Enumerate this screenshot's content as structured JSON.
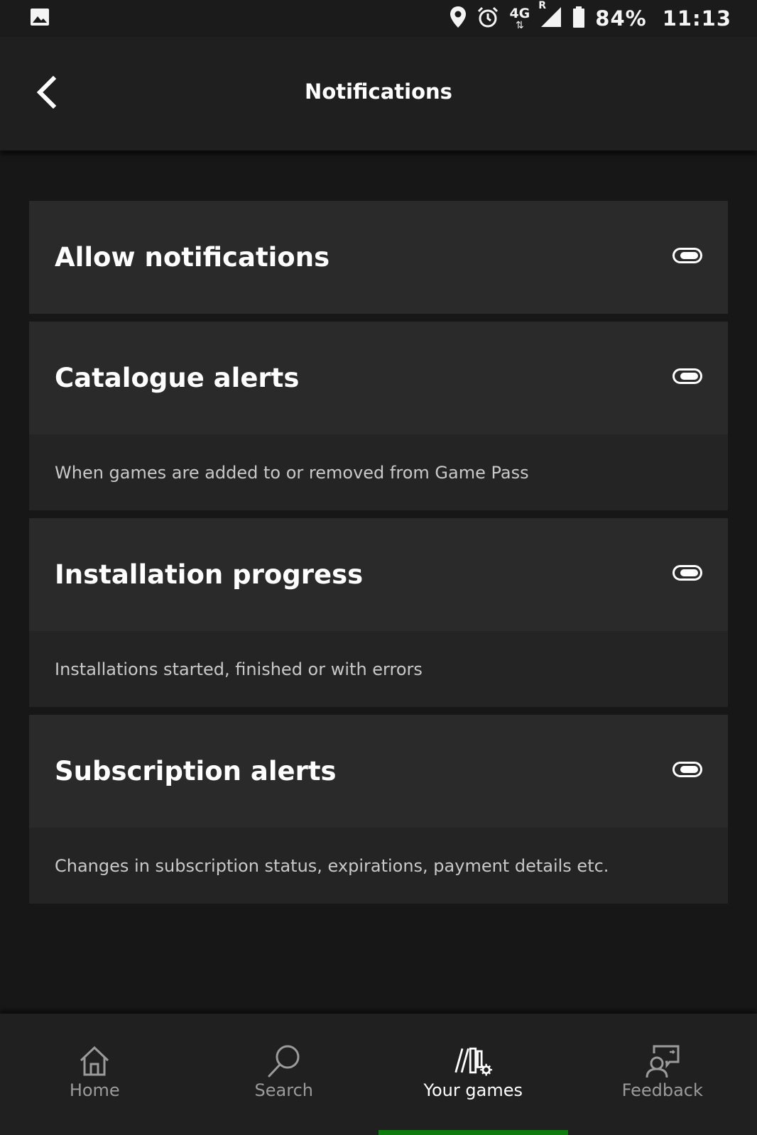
{
  "status_bar": {
    "network": "4G",
    "roaming": "R",
    "battery": "84%",
    "time": "11:13",
    "icons": [
      "image-icon",
      "location-icon",
      "alarm-icon",
      "signal-icon",
      "battery-icon"
    ]
  },
  "header": {
    "title": "Notifications",
    "back_icon": "chevron-left-icon"
  },
  "settings": [
    {
      "title": "Allow notifications",
      "description": null,
      "enabled": true
    },
    {
      "title": "Catalogue alerts",
      "description": "When games are added to or removed from Game Pass",
      "enabled": true
    },
    {
      "title": "Installation progress",
      "description": "Installations started, finished or with errors",
      "enabled": true
    },
    {
      "title": "Subscription alerts",
      "description": "Changes in subscription status, expirations, payment details etc.",
      "enabled": true
    }
  ],
  "bottom_nav": {
    "items": [
      {
        "label": "Home",
        "icon": "home-icon",
        "active": false
      },
      {
        "label": "Search",
        "icon": "search-icon",
        "active": false
      },
      {
        "label": "Your games",
        "icon": "library-icon",
        "active": true
      },
      {
        "label": "Feedback",
        "icon": "feedback-icon",
        "active": false
      }
    ]
  },
  "colors": {
    "background": "#171717",
    "card": "#2a2a2a",
    "accent": "#107c10"
  }
}
